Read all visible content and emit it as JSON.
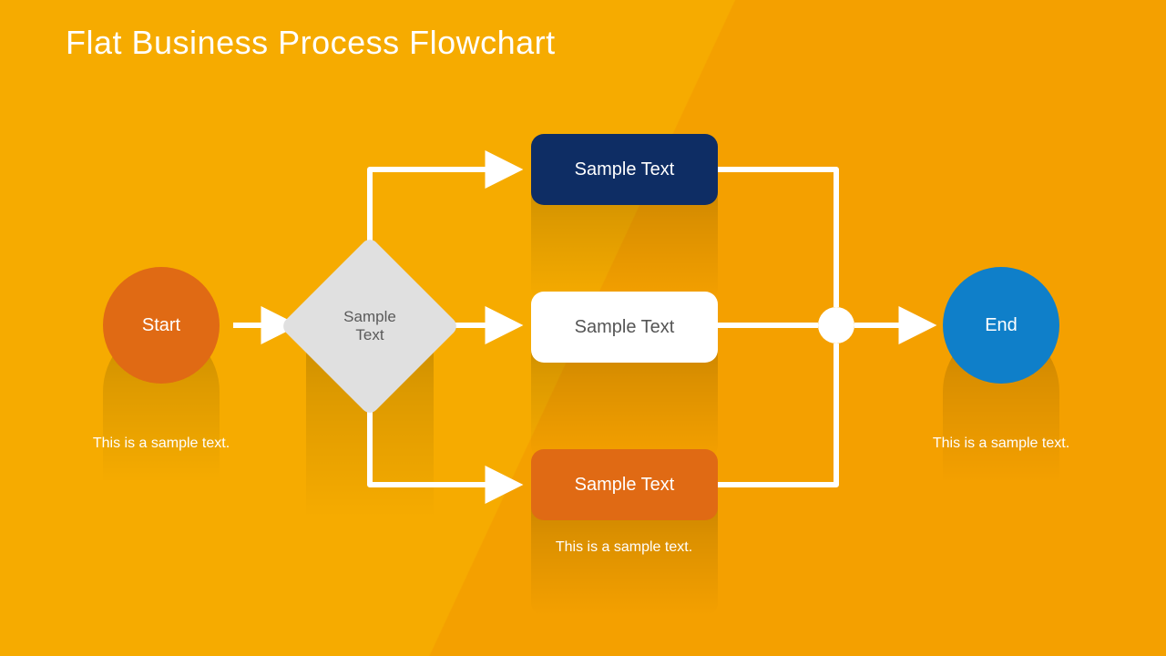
{
  "title": "Flat Business Process Flowchart",
  "nodes": {
    "start": {
      "label": "Start",
      "caption": "This is a sample text."
    },
    "decision": {
      "label": "Sample\nText"
    },
    "top": {
      "label": "Sample Text"
    },
    "mid": {
      "label": "Sample Text"
    },
    "bot": {
      "label": "Sample Text",
      "caption": "This is a sample text."
    },
    "end": {
      "label": "End",
      "caption": "This is a sample text."
    }
  },
  "colors": {
    "bg_primary": "#f6ab00",
    "bg_secondary": "#f4a000",
    "start": "#e06a14",
    "end": "#0f7fc9",
    "navy": "#0e2d64",
    "white": "#ffffff",
    "diamond": "#e0e0e0",
    "connector": "#ffffff"
  },
  "diagram": {
    "type": "flowchart",
    "nodes": [
      {
        "id": "start",
        "kind": "terminator",
        "shape": "circle"
      },
      {
        "id": "decision",
        "kind": "decision",
        "shape": "diamond"
      },
      {
        "id": "top",
        "kind": "process",
        "shape": "rect"
      },
      {
        "id": "mid",
        "kind": "process",
        "shape": "rect"
      },
      {
        "id": "bot",
        "kind": "process",
        "shape": "rect"
      },
      {
        "id": "junction",
        "kind": "connector",
        "shape": "circle"
      },
      {
        "id": "end",
        "kind": "terminator",
        "shape": "circle"
      }
    ],
    "edges": [
      {
        "from": "start",
        "to": "decision"
      },
      {
        "from": "decision",
        "to": "top"
      },
      {
        "from": "decision",
        "to": "mid"
      },
      {
        "from": "decision",
        "to": "bot"
      },
      {
        "from": "top",
        "to": "junction"
      },
      {
        "from": "mid",
        "to": "junction"
      },
      {
        "from": "bot",
        "to": "junction"
      },
      {
        "from": "junction",
        "to": "end"
      }
    ]
  }
}
